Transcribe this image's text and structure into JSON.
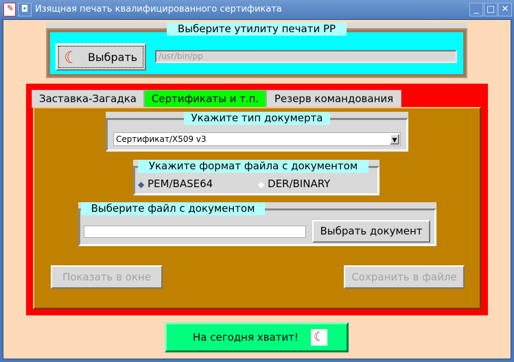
{
  "window": {
    "title": "Изящная печать квалифицированного сертификата"
  },
  "printer": {
    "frame_label": "Выберите утилиту печати PP",
    "choose_label": "Выбрать",
    "path": "/usr/bin/pp"
  },
  "tabs": [
    {
      "label": "Заставка-Загадка"
    },
    {
      "label": "Сертификаты и т.п."
    },
    {
      "label": "Резерв командования"
    }
  ],
  "doc_type": {
    "label": "Укажите тип докумерта",
    "value": "Сертификат/X509 v3"
  },
  "format": {
    "label": "Укажите формат файла с документом",
    "options": [
      {
        "label": "PEM/BASE64",
        "selected": true
      },
      {
        "label": "DER/BINARY",
        "selected": false
      }
    ]
  },
  "file": {
    "label": "Выберите файл с документом",
    "value": "",
    "button": "Выбрать документ"
  },
  "actions": {
    "show": "Показать в окне",
    "save": "Сохранить в файле"
  },
  "quit": {
    "label": "На сегодня хватит!"
  }
}
